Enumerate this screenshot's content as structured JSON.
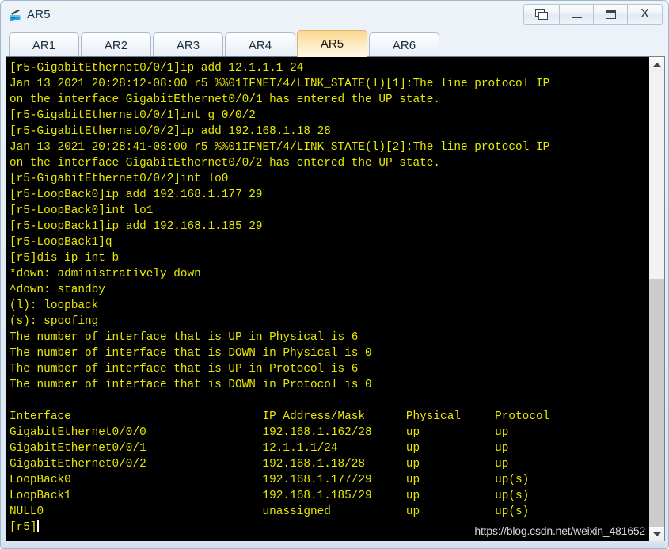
{
  "window": {
    "title": "AR5",
    "app_icon": "router-icon",
    "controls": [
      {
        "name": "restore-button",
        "icon": "restore-windows-icon",
        "label": ""
      },
      {
        "name": "minimize-button",
        "icon": "minimize-icon",
        "label": ""
      },
      {
        "name": "maximize-button",
        "icon": "maximize-icon",
        "label": ""
      },
      {
        "name": "close-button",
        "icon": "close-icon",
        "label": "X"
      }
    ]
  },
  "tabs": [
    {
      "label": "AR1",
      "active": false
    },
    {
      "label": "AR2",
      "active": false
    },
    {
      "label": "AR3",
      "active": false
    },
    {
      "label": "AR4",
      "active": false
    },
    {
      "label": "AR5",
      "active": true
    },
    {
      "label": "AR6",
      "active": false
    }
  ],
  "terminal": {
    "foreground_color": "#e8e800",
    "background_color": "#000000",
    "cursor_color": "#ffffff",
    "lines": [
      "[r5-GigabitEthernet0/0/1]ip add 12.1.1.1 24",
      "Jan 13 2021 20:28:12-08:00 r5 %%01IFNET/4/LINK_STATE(l)[1]:The line protocol IP",
      "on the interface GigabitEthernet0/0/1 has entered the UP state.",
      "[r5-GigabitEthernet0/0/1]int g 0/0/2",
      "[r5-GigabitEthernet0/0/2]ip add 192.168.1.18 28",
      "Jan 13 2021 20:28:41-08:00 r5 %%01IFNET/4/LINK_STATE(l)[2]:The line protocol IP",
      "on the interface GigabitEthernet0/0/2 has entered the UP state.",
      "[r5-GigabitEthernet0/0/2]int lo0",
      "[r5-LoopBack0]ip add 192.168.1.177 29",
      "[r5-LoopBack0]int lo1",
      "[r5-LoopBack1]ip add 192.168.1.185 29",
      "[r5-LoopBack1]q",
      "[r5]dis ip int b",
      "*down: administratively down",
      "^down: standby",
      "(l): loopback",
      "(s): spoofing",
      "The number of interface that is UP in Physical is 6",
      "The number of interface that is DOWN in Physical is 0",
      "The number of interface that is UP in Protocol is 6",
      "The number of interface that is DOWN in Protocol is 0",
      "",
      "Interface                            IP Address/Mask      Physical     Protocol",
      "GigabitEthernet0/0/0                 192.168.1.162/28     up           up",
      "GigabitEthernet0/0/1                 12.1.1.1/24          up           up",
      "GigabitEthernet0/0/2                 192.168.1.18/28      up           up",
      "LoopBack0                            192.168.1.177/29     up           up(s)",
      "LoopBack1                            192.168.1.185/29     up           up(s)",
      "NULL0                                unassigned           up           up(s)"
    ],
    "prompt": "[r5]",
    "interface_table": {
      "headers": [
        "Interface",
        "IP Address/Mask",
        "Physical",
        "Protocol"
      ],
      "rows": [
        [
          "GigabitEthernet0/0/0",
          "192.168.1.162/28",
          "up",
          "up"
        ],
        [
          "GigabitEthernet0/0/1",
          "12.1.1.1/24",
          "up",
          "up"
        ],
        [
          "GigabitEthernet0/0/2",
          "192.168.1.18/28",
          "up",
          "up"
        ],
        [
          "LoopBack0",
          "192.168.1.177/29",
          "up",
          "up(s)"
        ],
        [
          "LoopBack1",
          "192.168.1.185/29",
          "up",
          "up(s)"
        ],
        [
          "NULL0",
          "unassigned",
          "up",
          "up(s)"
        ]
      ]
    }
  },
  "scrollbar": {
    "up_arrow": "chevron-up-icon",
    "down_arrow": "chevron-down-icon"
  },
  "watermark": {
    "text": "https://blog.csdn.net/weixin_481652"
  }
}
